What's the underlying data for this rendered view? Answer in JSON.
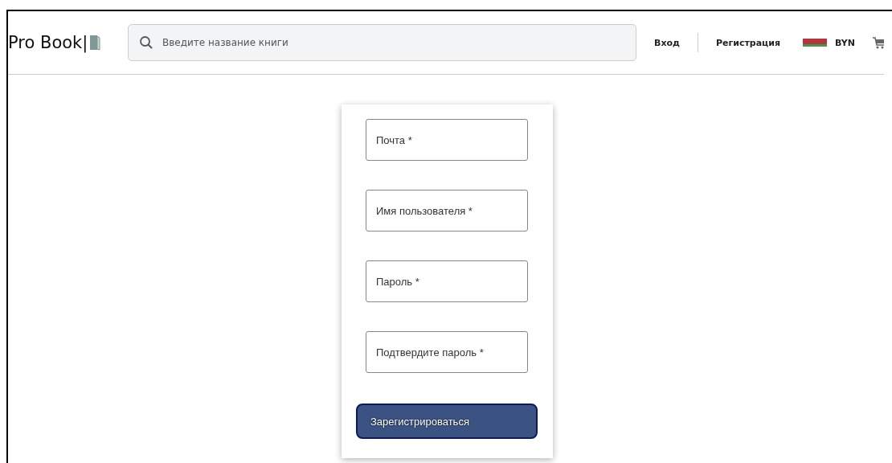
{
  "header": {
    "logo": "Pro Book|",
    "search": {
      "placeholder": "Введите название книги"
    },
    "nav": [
      {
        "kind": "link",
        "label": "Вход"
      },
      {
        "kind": "link",
        "label": "Регистрация"
      },
      {
        "kind": "currency",
        "label": "BYN"
      }
    ]
  },
  "form": {
    "fields": [
      {
        "placeholder": "Почта *"
      },
      {
        "placeholder": "Имя пользователя *"
      },
      {
        "placeholder": "Пароль *"
      },
      {
        "placeholder": "Подтвердите пароль *"
      }
    ],
    "submit": "Зарегистрироваться"
  }
}
